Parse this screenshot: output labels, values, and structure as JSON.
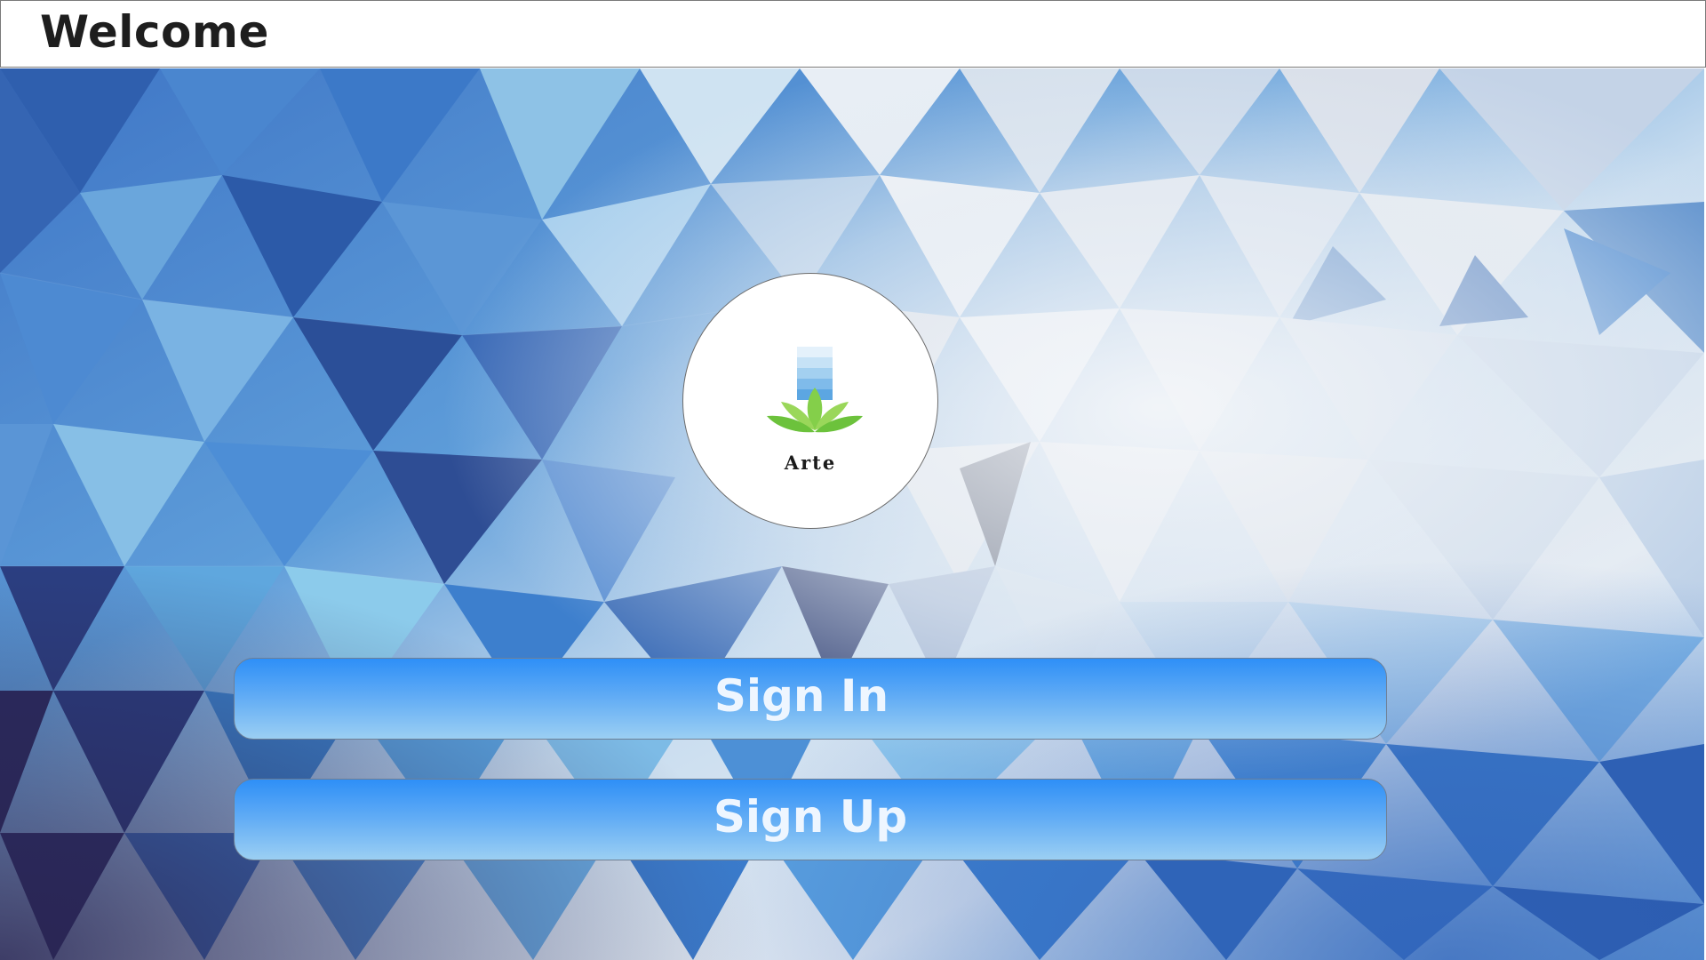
{
  "window": {
    "title": "Welcome"
  },
  "logo": {
    "brand_text": "Arte",
    "icon": "lotus-icon"
  },
  "buttons": {
    "sign_in_label": "Sign In",
    "sign_up_label": "Sign Up"
  },
  "colors": {
    "button_top": "#2e8ff7",
    "button_bottom": "#9bcff3",
    "button_text": "#eef6ff",
    "lotus_green": "#7ecb45",
    "background_blue": "#3a78c2"
  }
}
